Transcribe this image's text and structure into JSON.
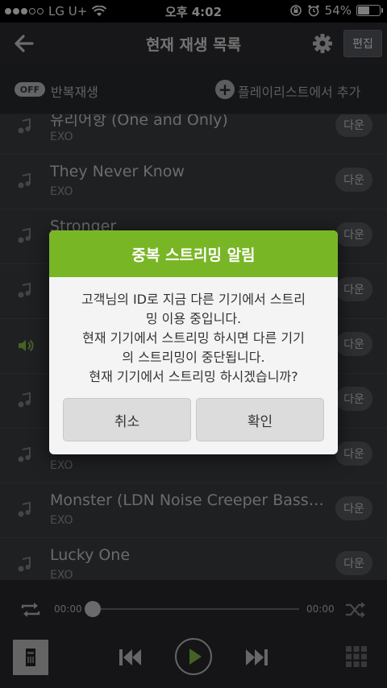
{
  "statusbar": {
    "carrier": "LG U+",
    "time": "오후 4:02",
    "battery": "54%",
    "battery_level": 0.54
  },
  "header": {
    "title": "현재 재생 목록",
    "edit_label": "편집"
  },
  "controls": {
    "repeat_toggle": "OFF",
    "repeat_label": "반복재생",
    "add_playlist_label": "플레이리스트에서 추가"
  },
  "songs": [
    {
      "title": "유리어항 (One and Only)",
      "artist": "EXO",
      "download": "다운"
    },
    {
      "title": "They Never Know",
      "artist": "EXO",
      "download": "다운"
    },
    {
      "title": "Stronger",
      "artist": "",
      "download": "다운"
    },
    {
      "title": "",
      "artist": "",
      "download": "다운"
    },
    {
      "title": "",
      "artist": "",
      "download": "다운"
    },
    {
      "title": "",
      "artist": "",
      "download": "다운"
    },
    {
      "title": "",
      "artist": "EXO",
      "download": "다운"
    },
    {
      "title": "Monster (LDN Noise Creeper Bass…",
      "artist": "EXO",
      "download": "다운"
    },
    {
      "title": "Lucky One",
      "artist": "EXO",
      "download": "다운"
    }
  ],
  "player": {
    "elapsed": "00:00",
    "total": "00:00",
    "progress": 0
  },
  "dialog": {
    "title": "중복 스트리밍 알림",
    "line1": "고객님의 ID로 지금 다른 기기에서 스트리",
    "line2": "밍 이용 중입니다.",
    "line3": "현재 기기에서 스트리밍 하시면 다른 기기",
    "line4": "의 스트리밍이 중단됩니다.",
    "line5": "현재 기기에서 스트리밍 하시겠습니까?",
    "cancel_label": "취소",
    "confirm_label": "확인"
  },
  "colors": {
    "accent": "#79b626",
    "playing": "#8bc34a"
  }
}
